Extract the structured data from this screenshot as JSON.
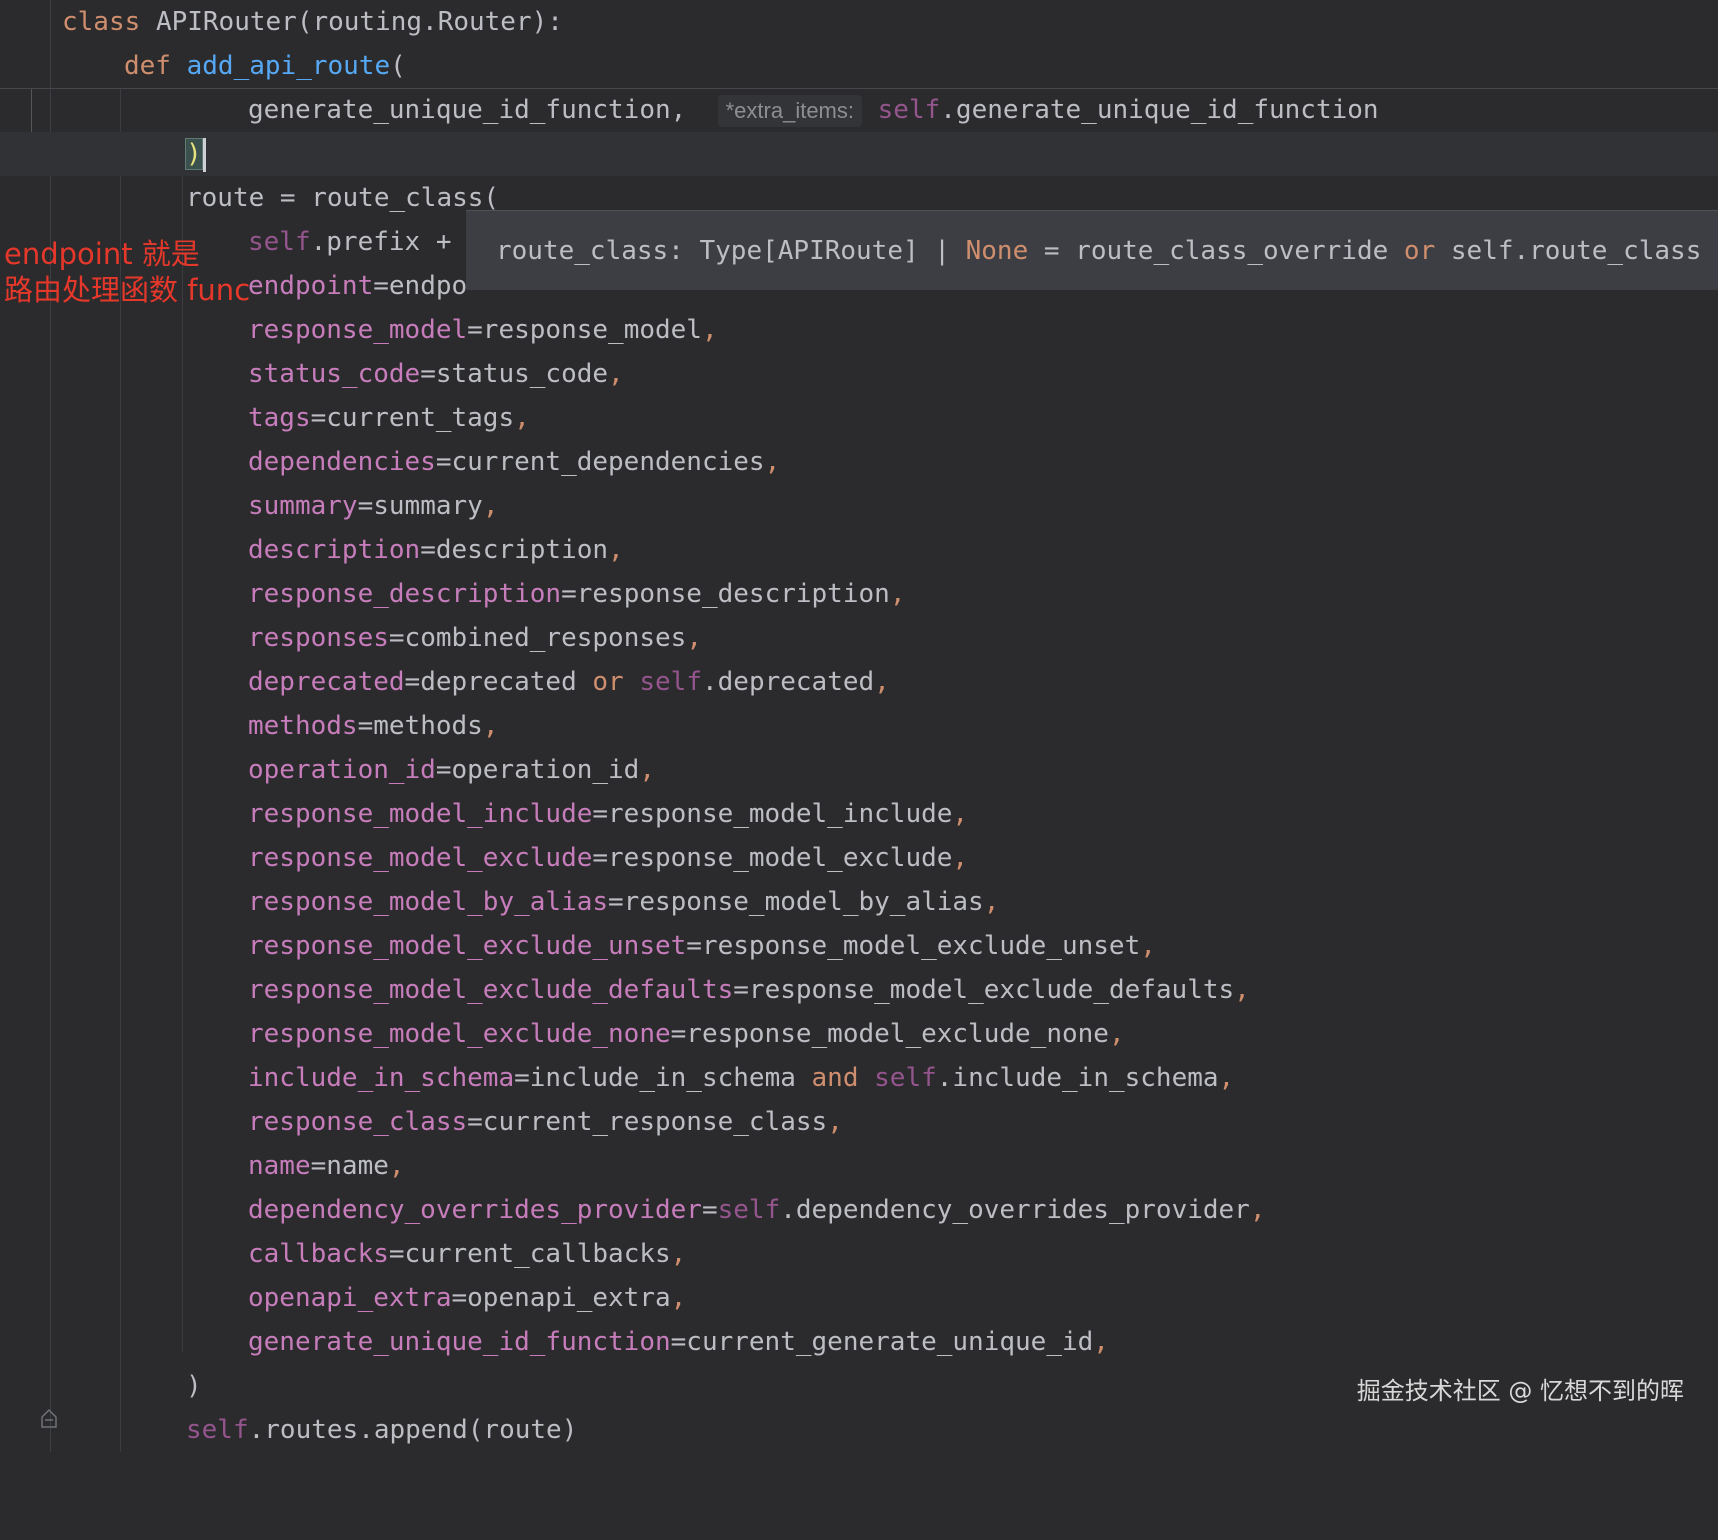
{
  "editor": {
    "sticky": {
      "class_kw": "class",
      "class_name": "APIRouter(routing.Router):",
      "def_kw": "def",
      "method_name": "add_api_route",
      "method_paren": "("
    },
    "gen_line": {
      "text": "generate_unique_id_function,",
      "hint": "*extra_items:",
      "self_kw": "self",
      "rest": ".generate_unique_id_function"
    },
    "close_paren": ")",
    "route_line": "route = route_class(",
    "prefix_line": {
      "self_kw": "self",
      "rest": ".prefix +"
    },
    "endpoint_line": {
      "param": "endpoint",
      "rest": "=endpo"
    },
    "args": [
      {
        "param": "response_model",
        "value": "=response_model",
        "comma": ","
      },
      {
        "param": "status_code",
        "value": "=status_code",
        "comma": ","
      },
      {
        "param": "tags",
        "value": "=current_tags",
        "comma": ","
      },
      {
        "param": "dependencies",
        "value": "=current_dependencies",
        "comma": ","
      },
      {
        "param": "summary",
        "value": "=summary",
        "comma": ","
      },
      {
        "param": "description",
        "value": "=description",
        "comma": ","
      },
      {
        "param": "response_description",
        "value": "=response_description",
        "comma": ","
      },
      {
        "param": "responses",
        "value": "=combined_responses",
        "comma": ","
      },
      {
        "param": "deprecated",
        "value": "=deprecated ",
        "kw": "or",
        "self_kw": "self",
        "tail": ".deprecated",
        "comma": ","
      },
      {
        "param": "methods",
        "value": "=methods",
        "comma": ","
      },
      {
        "param": "operation_id",
        "value": "=operation_id",
        "comma": ","
      },
      {
        "param": "response_model_include",
        "value": "=response_model_include",
        "comma": ","
      },
      {
        "param": "response_model_exclude",
        "value": "=response_model_exclude",
        "comma": ","
      },
      {
        "param": "response_model_by_alias",
        "value": "=response_model_by_alias",
        "comma": ","
      },
      {
        "param": "response_model_exclude_unset",
        "value": "=response_model_exclude_unset",
        "comma": ","
      },
      {
        "param": "response_model_exclude_defaults",
        "value": "=response_model_exclude_defaults",
        "comma": ","
      },
      {
        "param": "response_model_exclude_none",
        "value": "=response_model_exclude_none",
        "comma": ","
      },
      {
        "param": "include_in_schema",
        "value": "=include_in_schema ",
        "kw": "and",
        "self_kw": "self",
        "tail": ".include_in_schema",
        "comma": ","
      },
      {
        "param": "response_class",
        "value": "=current_response_class",
        "comma": ","
      },
      {
        "param": "name",
        "value": "=name",
        "comma": ","
      },
      {
        "param": "dependency_overrides_provider",
        "value": "=",
        "self_kw": "self",
        "tail": ".dependency_overrides_provider",
        "comma": ","
      },
      {
        "param": "callbacks",
        "value": "=current_callbacks",
        "comma": ","
      },
      {
        "param": "openapi_extra",
        "value": "=openapi_extra",
        "comma": ","
      },
      {
        "param": "generate_unique_id_function",
        "value": "=current_generate_unique_id",
        "comma": ","
      }
    ],
    "end_paren": ")",
    "append_line": {
      "self_kw": "self",
      "rest": ".routes.append(route)"
    }
  },
  "tooltip": {
    "name": "route_class: Type[APIRoute] | ",
    "none_kw": "None",
    "mid": " = route_class_override ",
    "or_kw": "or",
    "tail": " self.route_class"
  },
  "annotation": {
    "line1": "endpoint 就是",
    "line2": "路由处理函数 func"
  },
  "watermark": "掘金技术社区 @ 忆想不到的晖",
  "colors": {
    "background": "#2b2b2d",
    "keyword": "#cf8e6d",
    "param": "#c77dbb",
    "annotation": "#e5382b"
  }
}
